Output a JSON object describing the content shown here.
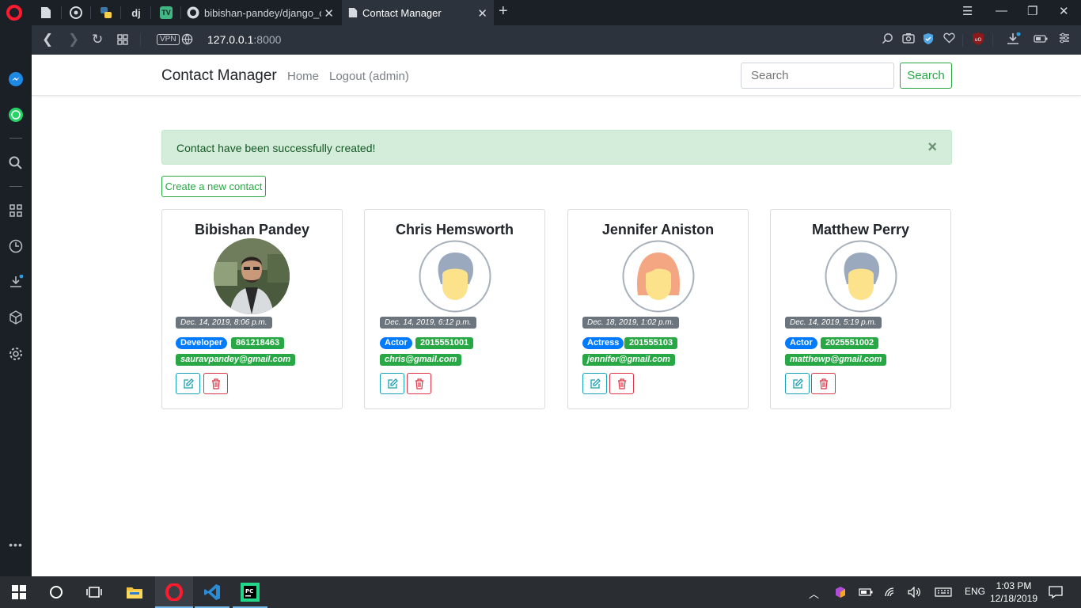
{
  "browser": {
    "tabs": [
      {
        "title": "bibishan-pandey/django_co"
      },
      {
        "title": "Contact Manager"
      }
    ],
    "address": {
      "host": "127.0.0.1",
      "port": ":8000"
    },
    "vpn_label": "VPN"
  },
  "navbar": {
    "brand": "Contact Manager",
    "links": [
      "Home",
      "Logout (admin)"
    ],
    "search_placeholder": "Search",
    "search_button": "Search"
  },
  "alert": {
    "message": "Contact have been successfully created!",
    "close": "×"
  },
  "create_button": "Create a new contact",
  "contacts": [
    {
      "name": "Bibishan Pandey",
      "date": "Dec. 14, 2019, 8:06 p.m.",
      "role": "Developer",
      "phone": "861218463",
      "email": "sauravpandey@gmail.com",
      "avatar": "photo"
    },
    {
      "name": "Chris Hemsworth",
      "date": "Dec. 14, 2019, 6:12 p.m.",
      "role": "Actor",
      "phone": "2015551001",
      "email": "chris@gmail.com",
      "avatar": "male"
    },
    {
      "name": "Jennifer Aniston",
      "date": "Dec. 18, 2019, 1:02 p.m.",
      "role": "Actress",
      "phone": "201555103",
      "email": "jennifer@gmail.com",
      "avatar": "female"
    },
    {
      "name": "Matthew Perry",
      "date": "Dec. 14, 2019, 5:19 p.m.",
      "role": "Actor",
      "phone": "2025551002",
      "email": "matthewp@gmail.com",
      "avatar": "male"
    }
  ],
  "taskbar": {
    "language": "ENG",
    "time": "1:03 PM",
    "date": "12/18/2019"
  },
  "colors": {
    "success": "#28a745",
    "primary": "#007bff",
    "secondary": "#6c757d",
    "info": "#17a2b8",
    "danger": "#dc3545",
    "alert_bg": "#d4edda"
  }
}
